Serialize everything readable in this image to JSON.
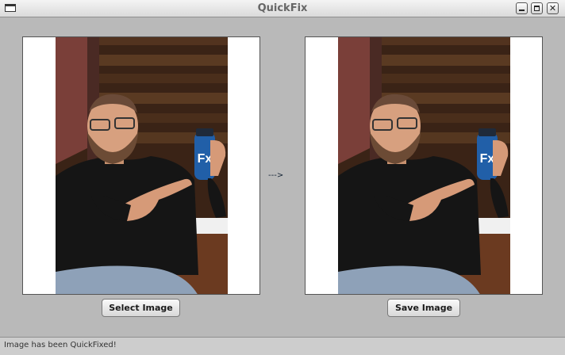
{
  "window": {
    "title": "QuickFix"
  },
  "main": {
    "arrow_text": "--->",
    "select_button": "Select Image",
    "save_button": "Save Image"
  },
  "status": {
    "text": "Image has been QuickFixed!"
  },
  "icons": [
    "window-menu-icon",
    "minimize-icon",
    "maximize-icon",
    "close-icon"
  ]
}
